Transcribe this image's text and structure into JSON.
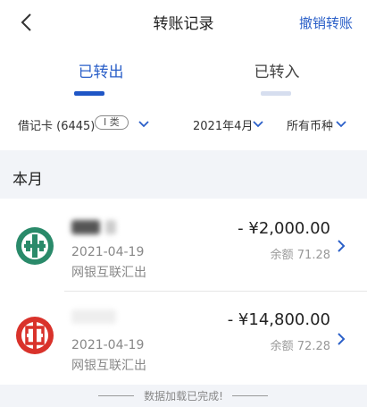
{
  "header": {
    "title": "转账记录",
    "cancel_label": "撤销转账"
  },
  "tabs": [
    {
      "label": "已转出",
      "active": true
    },
    {
      "label": "已转入",
      "active": false
    }
  ],
  "filters": {
    "card": "借记卡 (6445)",
    "card_type": "I 类",
    "month": "2021年4月",
    "currency": "所有币种"
  },
  "section_title": "本月",
  "transactions": [
    {
      "date": "2021-04-19",
      "method": "网银互联汇出",
      "amount": "- ¥2,000.00",
      "balance": "余额 71.28",
      "bank_icon": "agricultural-bank-icon"
    },
    {
      "date": "2021-04-19",
      "method": "网银互联汇出",
      "amount": "- ¥14,800.00",
      "balance": "余额 72.28",
      "bank_icon": "icbc-icon"
    }
  ],
  "footer_text": "数据加载已完成!",
  "colors": {
    "accent": "#2a5fc8",
    "abc_green": "#2a8a6a",
    "icbc_red": "#d9322b"
  }
}
